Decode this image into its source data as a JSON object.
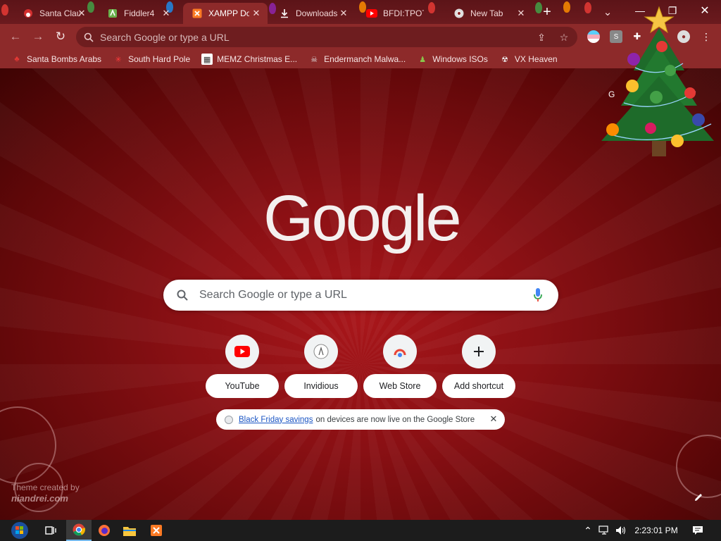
{
  "browser": {
    "tabs": [
      {
        "title": "Santa Claus",
        "icon": "santa-icon",
        "active": false
      },
      {
        "title": "Fiddler4",
        "icon": "fiddler-icon",
        "active": false
      },
      {
        "title": "XAMPP Do",
        "icon": "xampp-icon",
        "active": true
      },
      {
        "title": "Downloads",
        "icon": "download-icon",
        "active": false
      },
      {
        "title": "BFDI:TPOT",
        "icon": "youtube-icon",
        "active": false
      },
      {
        "title": "New Tab",
        "icon": "chrome-icon",
        "active": false
      }
    ],
    "omnibox_placeholder": "Search Google or type a URL",
    "bookmarks": [
      {
        "label": "Santa Bombs Arabs",
        "icon": "santa-icon"
      },
      {
        "label": "South Hard Pole",
        "icon": "snowflake-icon"
      },
      {
        "label": "MEMZ Christmas E...",
        "icon": "memz-icon"
      },
      {
        "label": "Endermanch Malwa...",
        "icon": "endermanch-icon"
      },
      {
        "label": "Windows ISOs",
        "icon": "windows-iso-icon"
      },
      {
        "label": "VX Heaven",
        "icon": "vx-heaven-icon"
      }
    ]
  },
  "ntp": {
    "logo_text": "Google",
    "search_placeholder": "Search Google or type a URL",
    "shortcuts": [
      {
        "label": "YouTube",
        "icon": "youtube-icon"
      },
      {
        "label": "Invidious",
        "icon": "invidious-icon"
      },
      {
        "label": "Web Store",
        "icon": "web-store-icon"
      },
      {
        "label": "Add shortcut",
        "icon": "plus-icon"
      }
    ],
    "promo": {
      "link_text": "Black Friday savings",
      "text": "on devices are now live on the Google Store"
    },
    "attribution": {
      "line1": "Theme created by",
      "brand": "niandrei.com"
    },
    "profile_initial": "G"
  },
  "taskbar": {
    "clock": "2:23:01 PM"
  },
  "colors": {
    "frame": "#5c1418",
    "toolbar": "#8d2a2a",
    "ntp_background": "#8a1014",
    "taskbar": "#1c1c1c"
  }
}
